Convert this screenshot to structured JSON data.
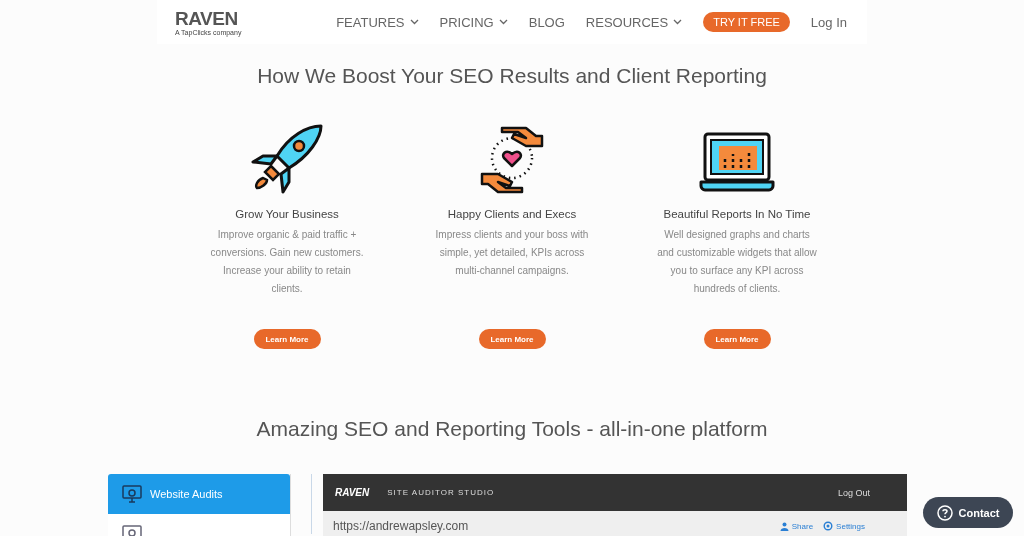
{
  "header": {
    "logo": "RAVEN",
    "logo_tagline": "A TapClicks company",
    "nav": [
      {
        "label": "FEATURES",
        "dropdown": true
      },
      {
        "label": "PRICING",
        "dropdown": true
      },
      {
        "label": "BLOG",
        "dropdown": false
      },
      {
        "label": "RESOURCES",
        "dropdown": true
      }
    ],
    "cta": "TRY IT FREE",
    "login": "Log In"
  },
  "boost": {
    "title": "How We Boost Your SEO Results and Client Reporting",
    "features": [
      {
        "kind": "rocket",
        "title": "Grow Your Business",
        "text": "Improve organic & paid traffic + conversions. Gain new customers. Increase your ability to retain clients.",
        "button": "Learn More"
      },
      {
        "kind": "hands",
        "title": "Happy Clients and Execs",
        "text": "Impress clients and your boss with simple, yet detailed, KPIs across multi-channel campaigns.",
        "button": "Learn More"
      },
      {
        "kind": "laptop",
        "title": "Beautiful Reports In No Time",
        "text": "Well designed graphs and charts and customizable widgets that allow you to surface any KPI across hundreds of clients.",
        "button": "Learn More"
      }
    ]
  },
  "tools": {
    "title": "Amazing SEO and Reporting Tools - all-in-one platform",
    "sidebar": [
      {
        "label": "Website Audits",
        "selected": true
      },
      {
        "selected": false
      }
    ],
    "preview": {
      "logo": "RAVEN",
      "title": "SITE AUDITOR STUDIO",
      "logout": "Log Out",
      "url": "https://andrewapsley.com",
      "actions": [
        "Share",
        "Settings"
      ]
    }
  },
  "contact": "Contact"
}
